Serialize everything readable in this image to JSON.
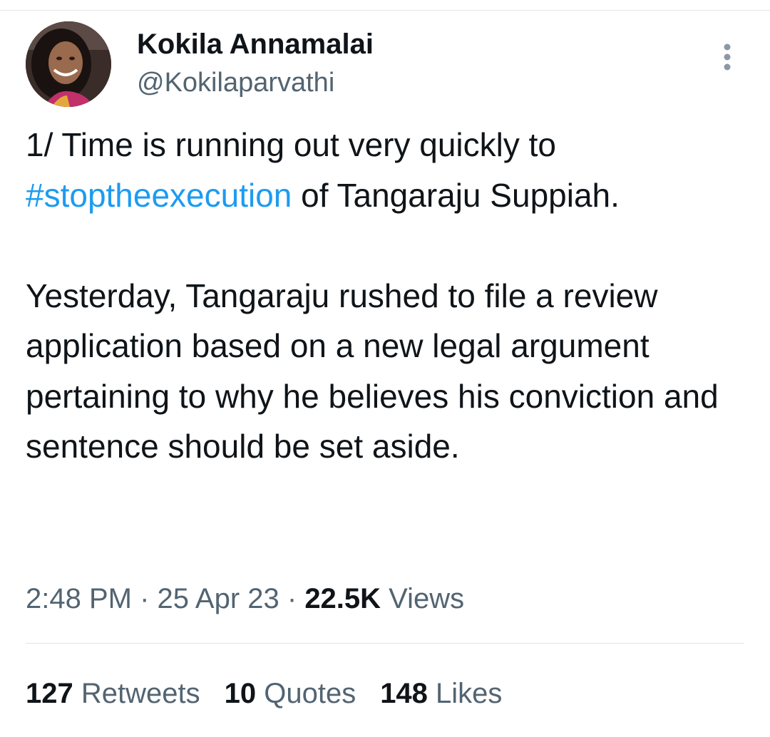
{
  "tweet": {
    "author": {
      "name": "Kokila Annamalai",
      "handle": "@Kokilaparvathi"
    },
    "text": {
      "p1_before": "1/ Time is running out very quickly to ",
      "hashtag": "#stoptheexecution",
      "p1_after": " of Tangaraju Suppiah.",
      "p2": "Yesterday, Tangaraju rushed to file a review application based on a new legal argument pertaining to why he believes his conviction and sentence should be set aside."
    },
    "meta": {
      "time": "2:48 PM",
      "separator": " · ",
      "date": "25 Apr 23",
      "views_count": "22.5K",
      "views_label": " Views"
    },
    "stats": {
      "retweets_count": "127",
      "retweets_label": " Retweets",
      "quotes_count": "10",
      "quotes_label": " Quotes",
      "likes_count": "148",
      "likes_label": " Likes"
    }
  },
  "icons": {
    "more": "more-vertical-icon"
  },
  "colors": {
    "text": "#0f1419",
    "secondary": "#536471",
    "link": "#1d9bf0"
  }
}
